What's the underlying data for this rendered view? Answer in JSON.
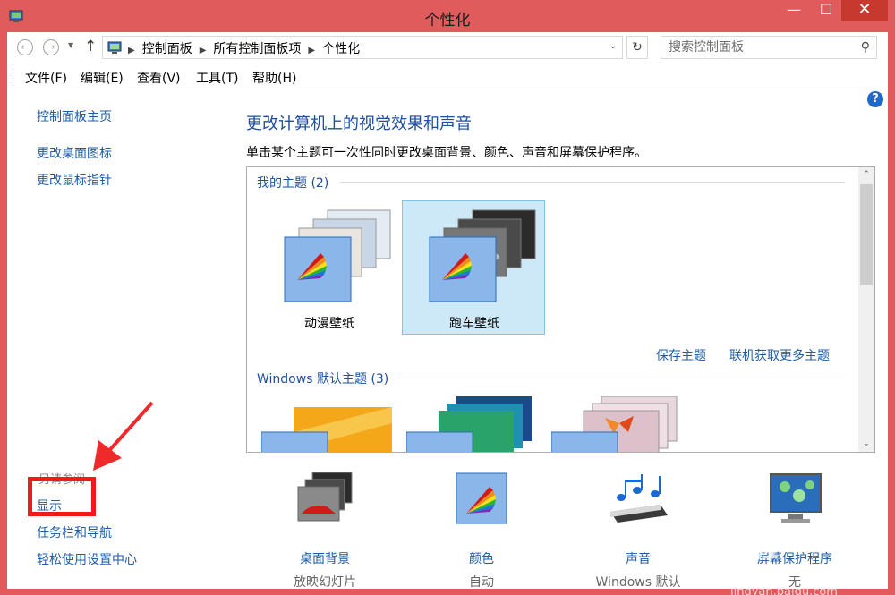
{
  "window": {
    "title": "个性化",
    "minimize": "—",
    "maximize": "☐",
    "close": "✕"
  },
  "address": {
    "crumbs": [
      "控制面板",
      "所有控制面板项",
      "个性化"
    ],
    "search_placeholder": "搜索控制面板"
  },
  "menu": [
    "文件(F)",
    "编辑(E)",
    "查看(V)",
    "工具(T)",
    "帮助(H)"
  ],
  "left_nav": {
    "home": "控制面板主页",
    "links": [
      "更改桌面图标",
      "更改鼠标指针"
    ],
    "see_also": "另请参阅",
    "see_also_links": [
      "显示",
      "任务栏和导航",
      "轻松使用设置中心"
    ]
  },
  "main": {
    "title": "更改计算机上的视觉效果和声音",
    "description": "单击某个主题可一次性同时更改桌面背景、颜色、声音和屏幕保护程序。",
    "my_themes_label": "我的主题 (2)",
    "my_themes": [
      {
        "name": "动漫壁纸",
        "selected": false
      },
      {
        "name": "跑车壁纸",
        "selected": true
      }
    ],
    "save_theme": "保存主题",
    "get_more": "联机获取更多主题",
    "default_themes_label": "Windows 默认主题 (3)"
  },
  "options": [
    {
      "label": "桌面背景",
      "sub": "放映幻灯片",
      "icon": "desktop-background-icon"
    },
    {
      "label": "颜色",
      "sub": "自动",
      "icon": "color-icon"
    },
    {
      "label": "声音",
      "sub": "Windows 默认",
      "icon": "sound-icon"
    },
    {
      "label": "屏幕保护程序",
      "sub": "无",
      "icon": "screensaver-icon"
    }
  ],
  "watermark": {
    "text": "Bai 经验",
    "url": "jingyan.baidu.com"
  },
  "colors": {
    "accent": "#1d5ca8",
    "frame": "#e05c5c",
    "selection": "#cde8f6",
    "highlight": "#f01a1a"
  }
}
